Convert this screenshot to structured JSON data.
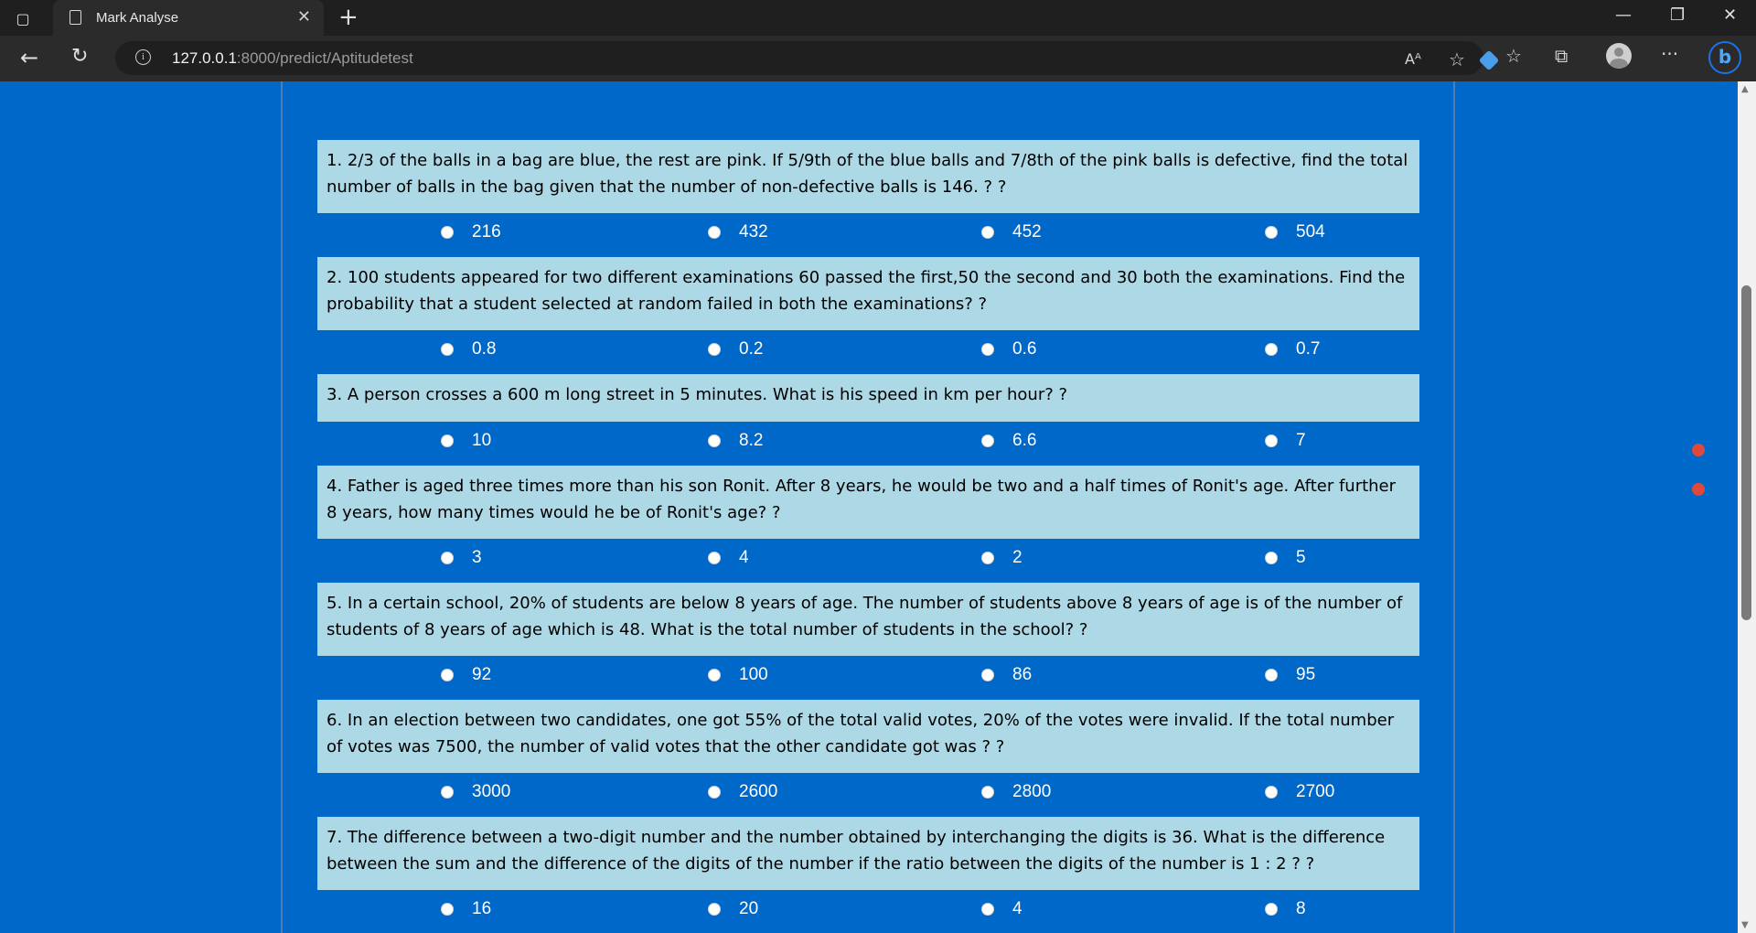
{
  "browser": {
    "tab_title": "Mark Analyse",
    "tab_close": "✕",
    "new_tab": "+",
    "url_host": "127.0.0.1",
    "url_path": ":8000/predict/Aptitudetest",
    "toolbar_icons": [
      "coupon-icon",
      "read-aloud-icon",
      "add-favorite-icon",
      "favorites-icon",
      "collections-icon",
      "profile-icon",
      "more-icon",
      "bing-icon"
    ],
    "window_controls": [
      "minimize",
      "restore",
      "close"
    ]
  },
  "questions": [
    {
      "text": "1. 2/3 of the balls in a bag are blue, the rest are pink. If 5/9th of the blue balls and 7/8th of the pink balls is defective, find the total number of balls in the bag given that the number of non-defective balls is 146. ? ?",
      "options": [
        "216",
        "432",
        "452",
        "504"
      ]
    },
    {
      "text": "2. 100 students appeared for two different examinations 60 passed the first,50 the second and 30 both the examinations. Find the probability that a student selected at random failed in both the examinations? ?",
      "options": [
        "0.8",
        "0.2",
        "0.6",
        "0.7"
      ]
    },
    {
      "text": "3. A person crosses a 600 m long street in 5 minutes. What is his speed in km per hour? ?",
      "options": [
        "10",
        "8.2",
        "6.6",
        "7"
      ]
    },
    {
      "text": "4. Father is aged three times more than his son Ronit. After 8 years, he would be two and a half times of Ronit's age. After further 8 years, how many times would he be of Ronit's age? ?",
      "options": [
        "3",
        "4",
        "2",
        "5"
      ]
    },
    {
      "text": "5. In a certain school, 20% of students are below 8 years of age. The number of students above 8 years of age is of the number of students of 8 years of age which is 48. What is the total number of students in the school? ?",
      "options": [
        "92",
        "100",
        "86",
        "95"
      ]
    },
    {
      "text": "6. In an election between two candidates, one got 55% of the total valid votes, 20% of the votes were invalid. If the total number of votes was 7500, the number of valid votes that the other candidate got was ? ?",
      "options": [
        "3000",
        "2600",
        "2800",
        "2700"
      ]
    },
    {
      "text": "7. The difference between a two-digit number and the number obtained by interchanging the digits is 36. What is the difference between the sum and the difference of the digits of the number if the ratio between the digits of the number is 1 : 2 ? ?",
      "options": [
        "16",
        "20",
        "4",
        "8"
      ]
    }
  ],
  "colors": {
    "page_background": "#0068c8",
    "question_background": "#add8e6",
    "indicator_dot": "#e0483c"
  }
}
